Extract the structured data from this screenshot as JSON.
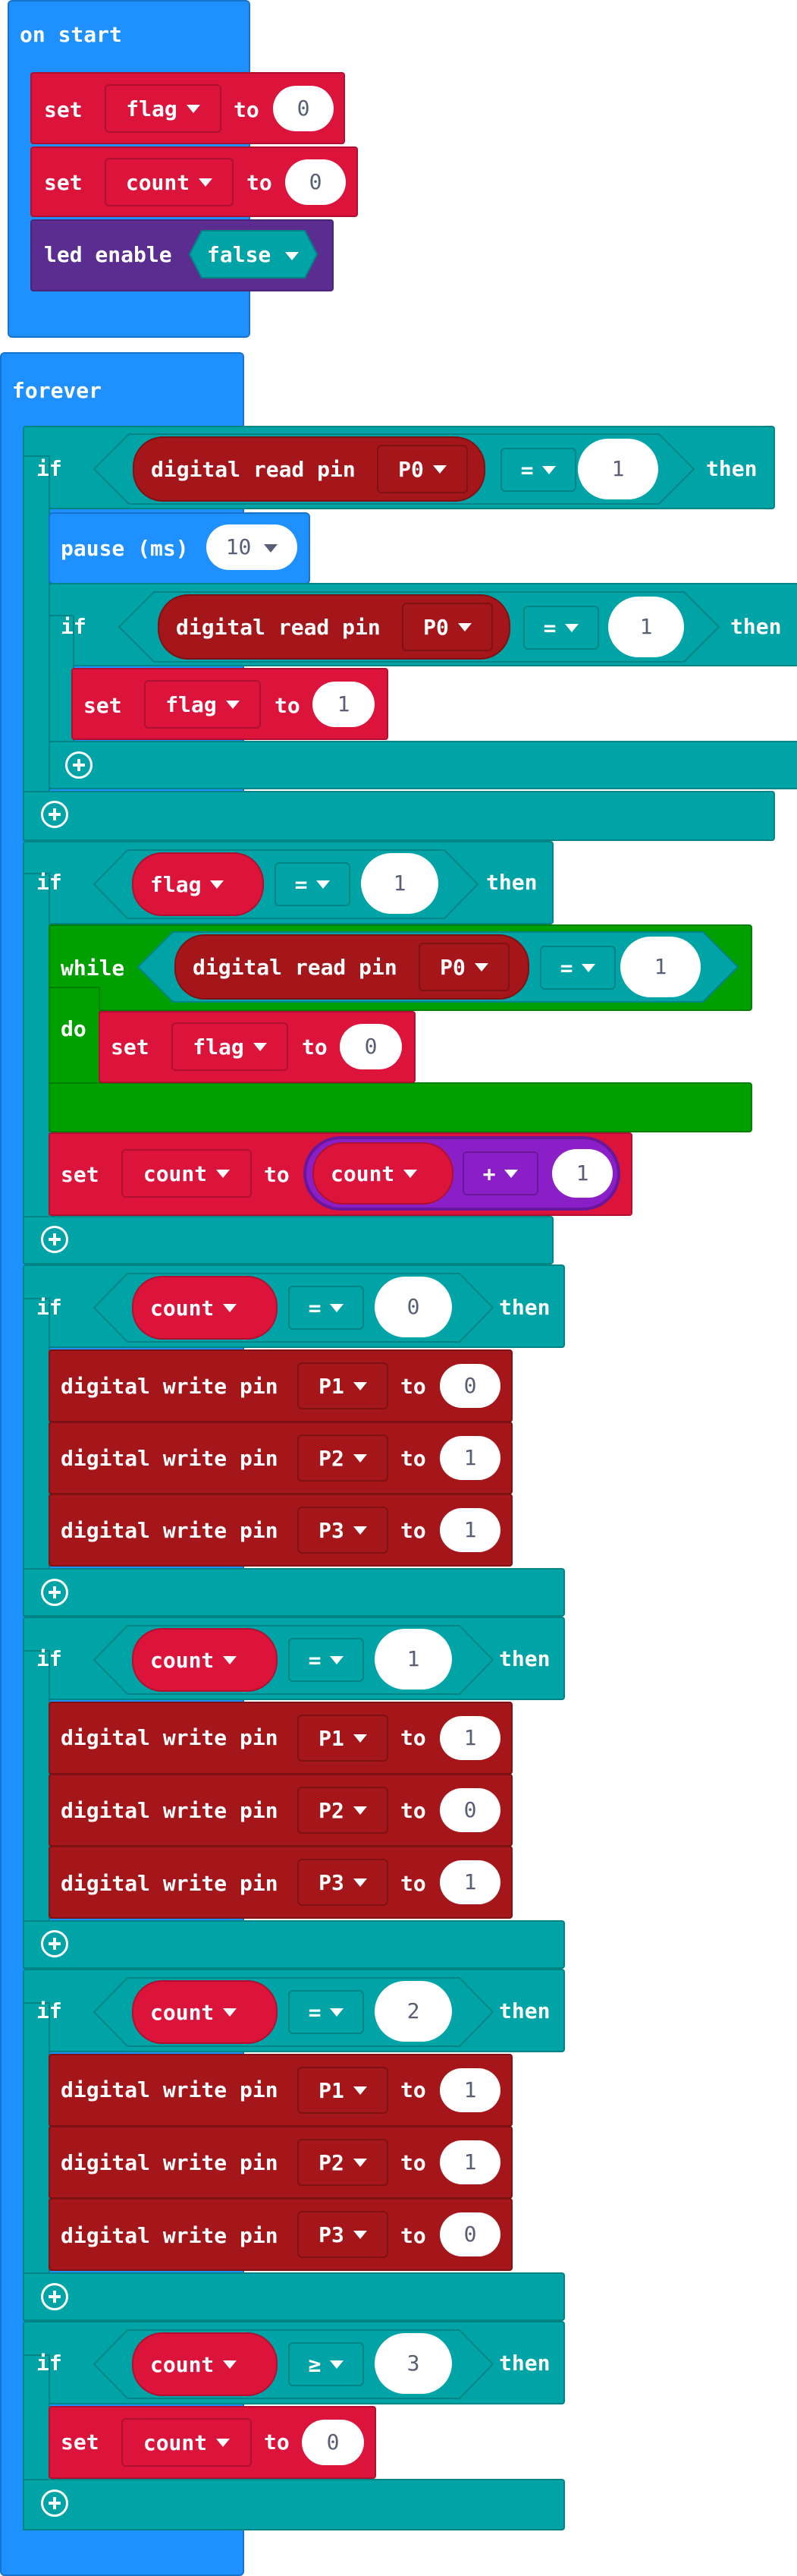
{
  "labels": {
    "on_start": "on start",
    "forever": "forever",
    "if_kw": "if",
    "then_kw": "then",
    "while_kw": "while",
    "do_kw": "do",
    "set_kw": "set",
    "to_kw": "to",
    "pause": "pause (ms)",
    "digital_read": "digital read pin",
    "digital_write": "digital write pin",
    "led_enable": "led enable"
  },
  "values": {
    "flag": "flag",
    "count": "count",
    "zero": "0",
    "one": "1",
    "two": "2",
    "three": "3",
    "ten": "10",
    "false": "false",
    "p0": "P0",
    "p1": "P1",
    "p2": "P2",
    "p3": "P3",
    "eq": "=",
    "gte": "≥",
    "plus": "+"
  },
  "colors": {
    "events": "#1e90ff",
    "logic": "#00a4a6",
    "variables": "#dc143c",
    "pins": "#a4161a",
    "led": "#5c2d91",
    "loops": "#00a000",
    "math": "#8a1fc8"
  }
}
